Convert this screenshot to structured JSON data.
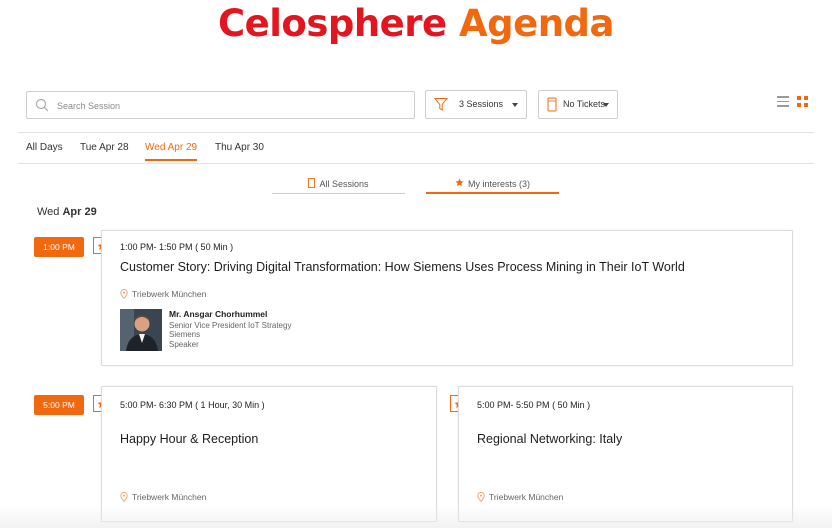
{
  "header": {
    "title_part1": "Celosphere",
    "title_part2": "Agenda"
  },
  "toolbar": {
    "search_placeholder": "Search Session",
    "sessions_filter": "3 Sessions",
    "tickets_filter": "No Tickets"
  },
  "day_tabs": [
    {
      "label": "All Days",
      "active": false
    },
    {
      "label": "Tue Apr 28",
      "active": false
    },
    {
      "label": "Wed Apr 29",
      "active": true
    },
    {
      "label": "Thu Apr 30",
      "active": false
    }
  ],
  "sub_tabs": [
    {
      "label": "All Sessions",
      "active": false
    },
    {
      "label": "My interests (3)",
      "active": true
    }
  ],
  "date_heading": {
    "weekday": "Wed",
    "date": "Apr 29"
  },
  "slots": [
    {
      "time_label": "1:00 PM",
      "sessions": [
        {
          "time": "1:00 PM- 1:50 PM",
          "duration": "( 50 Min )",
          "title": "Customer Story: Driving Digital Transformation: How Siemens Uses Process Mining in Their IoT World",
          "location": "Triebwerk München",
          "speaker": {
            "name": "Mr. Ansgar Chorhummel",
            "role": "Senior Vice President IoT Strategy",
            "company": "Siemens",
            "type": "Speaker"
          }
        }
      ]
    },
    {
      "time_label": "5:00 PM",
      "sessions": [
        {
          "time": "5:00 PM- 6:30 PM",
          "duration": "( 1 Hour, 30 Min )",
          "title": "Happy Hour & Reception",
          "location": "Triebwerk München"
        },
        {
          "time": "5:00 PM- 5:50 PM",
          "duration": "( 50 Min )",
          "title": "Regional Networking: Italy",
          "location": "Triebwerk München"
        }
      ]
    }
  ],
  "colors": {
    "accent": "#f2680e",
    "title_red": "#e3151f",
    "border": "#dcdcdc"
  },
  "icons": [
    "search-icon",
    "funnel-icon",
    "ticket-icon",
    "list-view-icon",
    "grid-view-icon",
    "star-icon",
    "location-pin-icon"
  ]
}
